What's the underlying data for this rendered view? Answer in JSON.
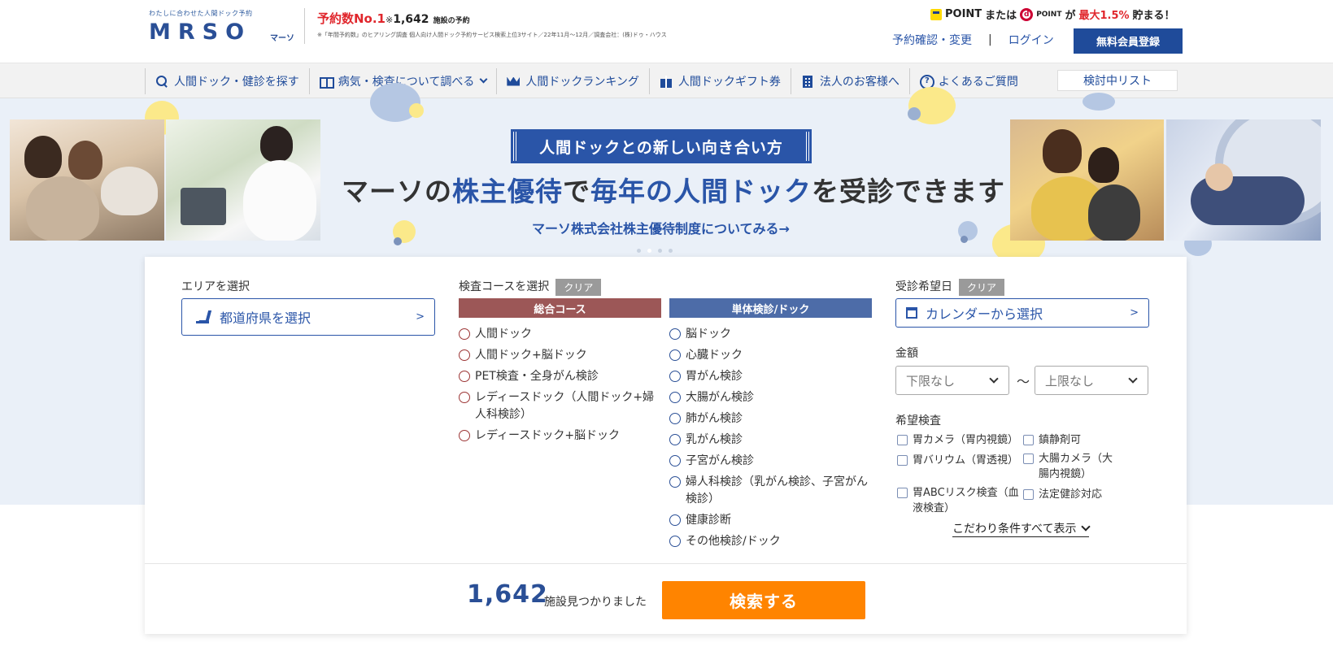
{
  "header": {
    "logo_tagline": "わたしに合わせた人間ドック予約",
    "logo_text": "MRSO",
    "logo_sub": "マーソ",
    "count_red": "予約数No.1",
    "count_note": "※",
    "count_number": "1,642",
    "count_tail": "施設の予約",
    "footnote": "※「年間予約数」のヒアリング調査 個人向け人間ドック予約サービス検索上位3サイト／22年11月～12月／調査会社：(株)ドゥ・ハウス",
    "points_text_1": "POINT",
    "points_text_2": "または",
    "points_text_3": "POINT",
    "points_text_4": "が",
    "points_red": "最大1.5%",
    "points_text_5": "貯まる！",
    "link_reservation": "予約確認・変更",
    "link_separator": "|",
    "link_login": "ログイン",
    "register_button": "無料会員登録"
  },
  "nav": {
    "items": [
      {
        "label": "人間ドック・健診を探す",
        "icon": "search-icon"
      },
      {
        "label": "病気・検査について調べる",
        "icon": "book-icon"
      },
      {
        "label": "人間ドックランキング",
        "icon": "crown-icon"
      },
      {
        "label": "人間ドックギフト券",
        "icon": "gift-icon"
      },
      {
        "label": "法人のお客様へ",
        "icon": "building-icon"
      },
      {
        "label": "よくあるご質問",
        "icon": "faq-icon"
      }
    ],
    "wishlist": "検討中リスト"
  },
  "banner": {
    "tagline": "人間ドックとの新しい向き合い方",
    "headline_1": "マーソの",
    "headline_2": "株主優待",
    "headline_3": "で",
    "headline_4": "毎年の人間ドック",
    "headline_5": "を受診できます",
    "link": "マーソ株式会社株主優待制度についてみる→"
  },
  "search": {
    "area_label": "エリアを選択",
    "area_select": "都道府県を選択",
    "area_arrow": ">",
    "course_label": "検査コースを選択",
    "clear": "クリア",
    "general_head": "総合コース",
    "single_head": "単体検診/ドック",
    "general_courses": [
      "人間ドック",
      "人間ドック+脳ドック",
      "PET検査・全身がん検診",
      "レディースドック（人間ドック+婦人科検診）",
      "レディースドック+脳ドック"
    ],
    "single_courses": [
      "脳ドック",
      "心臓ドック",
      "胃がん検診",
      "大腸がん検診",
      "肺がん検診",
      "乳がん検診",
      "子宮がん検診",
      "婦人科検診（乳がん検診、子宮がん検診）",
      "健康診断",
      "その他検診/ドック"
    ],
    "date_label": "受診希望日",
    "date_select": "カレンダーから選択",
    "date_arrow": ">",
    "price_label": "金額",
    "price_min": "下限なし",
    "price_tilde": "～",
    "price_max": "上限なし",
    "exam_label": "希望検査",
    "exams": [
      "胃カメラ（胃内視鏡）",
      "鎮静剤可",
      "胃バリウム（胃透視）",
      "大腸カメラ（大腸内視鏡）",
      "胃ABCリスク検査（血液検査）",
      "法定健診対応"
    ],
    "show_all": "こだわり条件すべて表示",
    "result_count": "1,642",
    "result_text": "施設見つかりました",
    "search_button": "検索する"
  },
  "colors": {
    "brand_blue": "#2a55a8",
    "search_orange": "#ff8400",
    "general_course": "#9c5757",
    "single_course": "#4d6ca8"
  }
}
